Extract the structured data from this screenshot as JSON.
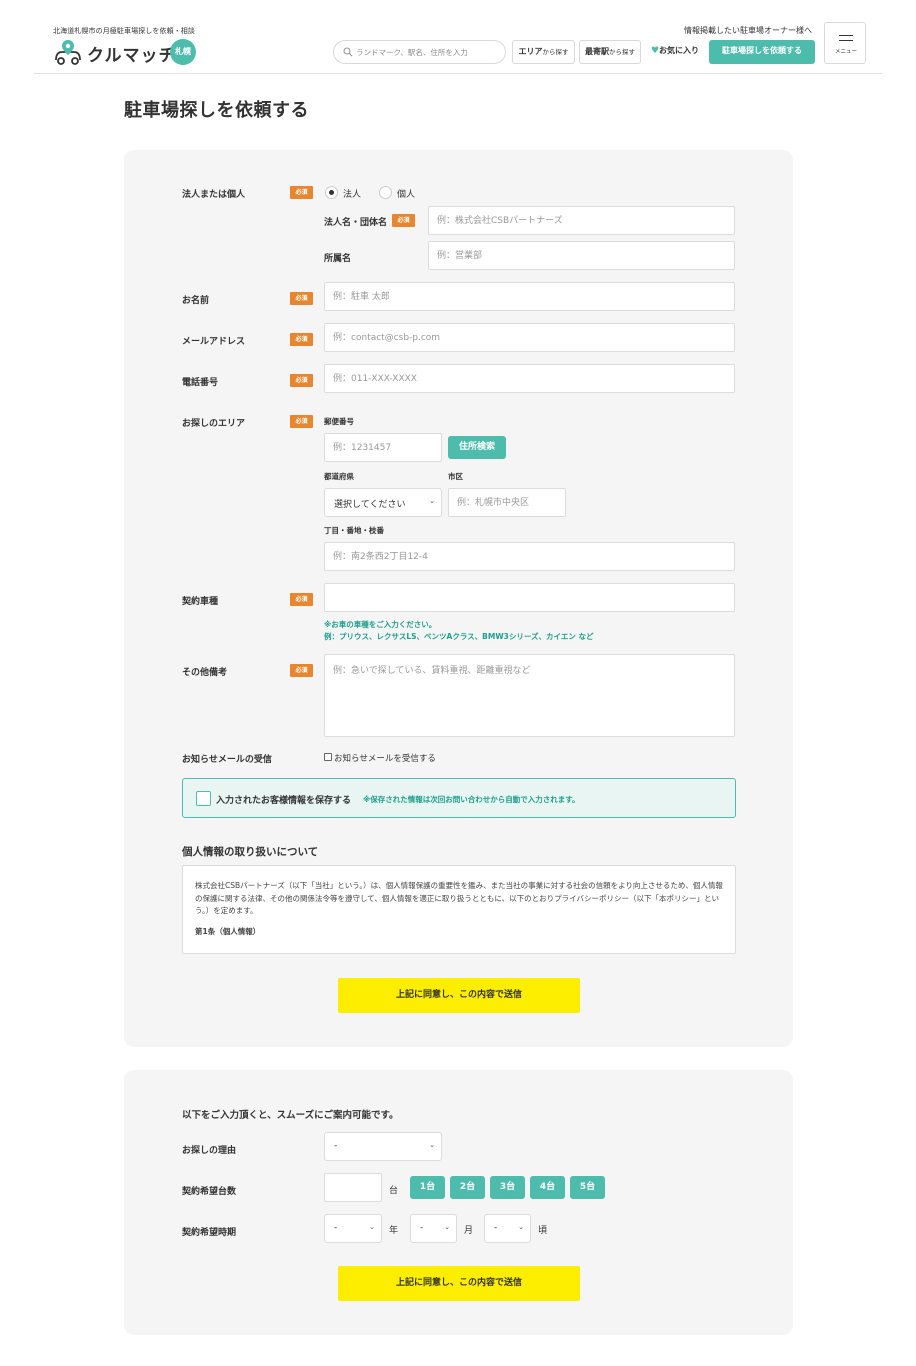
{
  "header": {
    "tagline": "北海道札幌市の月極駐車場探しを依頼・相談",
    "logo_text": "クルマッチ",
    "logo_badge": "札幌",
    "owner_link": "情報掲載したい駐車場オーナー様へ",
    "search_placeholder": "ランドマーク、駅名、住所を入力",
    "area_btn": {
      "main": "エリア",
      "sub": "から探す"
    },
    "station_btn": {
      "main": "最寄駅",
      "sub": "から探す"
    },
    "favorites_label": "お気に入り",
    "request_btn": "駐車場探しを依頼する",
    "menu_label": "メニュー",
    "accent_color": "#4dbcac"
  },
  "page_title": "駐車場探しを依頼する",
  "form": {
    "required_badge": "必須",
    "entity_type": {
      "label": "法人または個人",
      "options": [
        "法人",
        "個人"
      ],
      "selected": "法人"
    },
    "company_name": {
      "label": "法人名・団体名",
      "placeholder": "例：株式会社CSBパートナーズ"
    },
    "department": {
      "label": "所属名",
      "placeholder": "例：営業部"
    },
    "name": {
      "label": "お名前",
      "placeholder": "例：駐車 太郎"
    },
    "email": {
      "label": "メールアドレス",
      "placeholder": "例：contact@csb-p.com"
    },
    "phone": {
      "label": "電話番号",
      "placeholder": "例：011-XXX-XXXX"
    },
    "area": {
      "label": "お探しのエリア",
      "postal_label": "郵便番号",
      "postal_placeholder": "例：1231457",
      "address_search_btn": "住所検索",
      "prefecture_label": "都道府県",
      "prefecture_value": "選択してください",
      "city_label": "市区",
      "city_placeholder": "例：札幌市中央区",
      "street_label": "丁目・番地・枝番",
      "street_placeholder": "例：南2条西2丁目12-4"
    },
    "vehicle": {
      "label": "契約車種",
      "value": "",
      "note_line1": "※お車の車種をご入力ください。",
      "note_line2": "例：プリウス、レクサスLS、ベンツAクラス、BMW3シリーズ、カイエン など"
    },
    "remarks": {
      "label": "その他備考",
      "placeholder": "例：急いで探している、賃料重視、距離重視など"
    },
    "newsletter": {
      "label": "お知らせメールの受信",
      "checkbox_label": "お知らせメールを受信する"
    },
    "save_info": {
      "label": "入力されたお客様情報を保存する",
      "note": "※保存された情報は次回お問い合わせから自動で入力されます。"
    },
    "privacy": {
      "heading": "個人情報の取り扱いについて",
      "body": "株式会社CSBパートナーズ（以下「当社」という。）は、個人情報保護の重要性を鑑み、また当社の事業に対する社会の信頼をより向上させるため、個人情報の保護に関する法律、その他の関係法令等を遵守して、個人情報を適正に取り扱うとともに、以下のとおりプライバシーポリシー（以下「本ポリシー」という。）を定めます。",
      "article1": "第1条（個人情報）"
    },
    "submit_label": "上記に同意し、この内容で送信"
  },
  "extra": {
    "intro": "以下をご入力頂くと、スムーズにご案内可能です。",
    "reason": {
      "label": "お探しの理由",
      "value": "-"
    },
    "count": {
      "label": "契約希望台数",
      "unit": "台",
      "options": [
        "1台",
        "2台",
        "3台",
        "4台",
        "5台"
      ]
    },
    "timing": {
      "label": "契約希望時期",
      "year_value": "-",
      "year_unit": "年",
      "month_value": "-",
      "month_unit": "月",
      "day_value": "-",
      "day_unit": "頃"
    },
    "submit_label": "上記に同意し、この内容で送信"
  }
}
